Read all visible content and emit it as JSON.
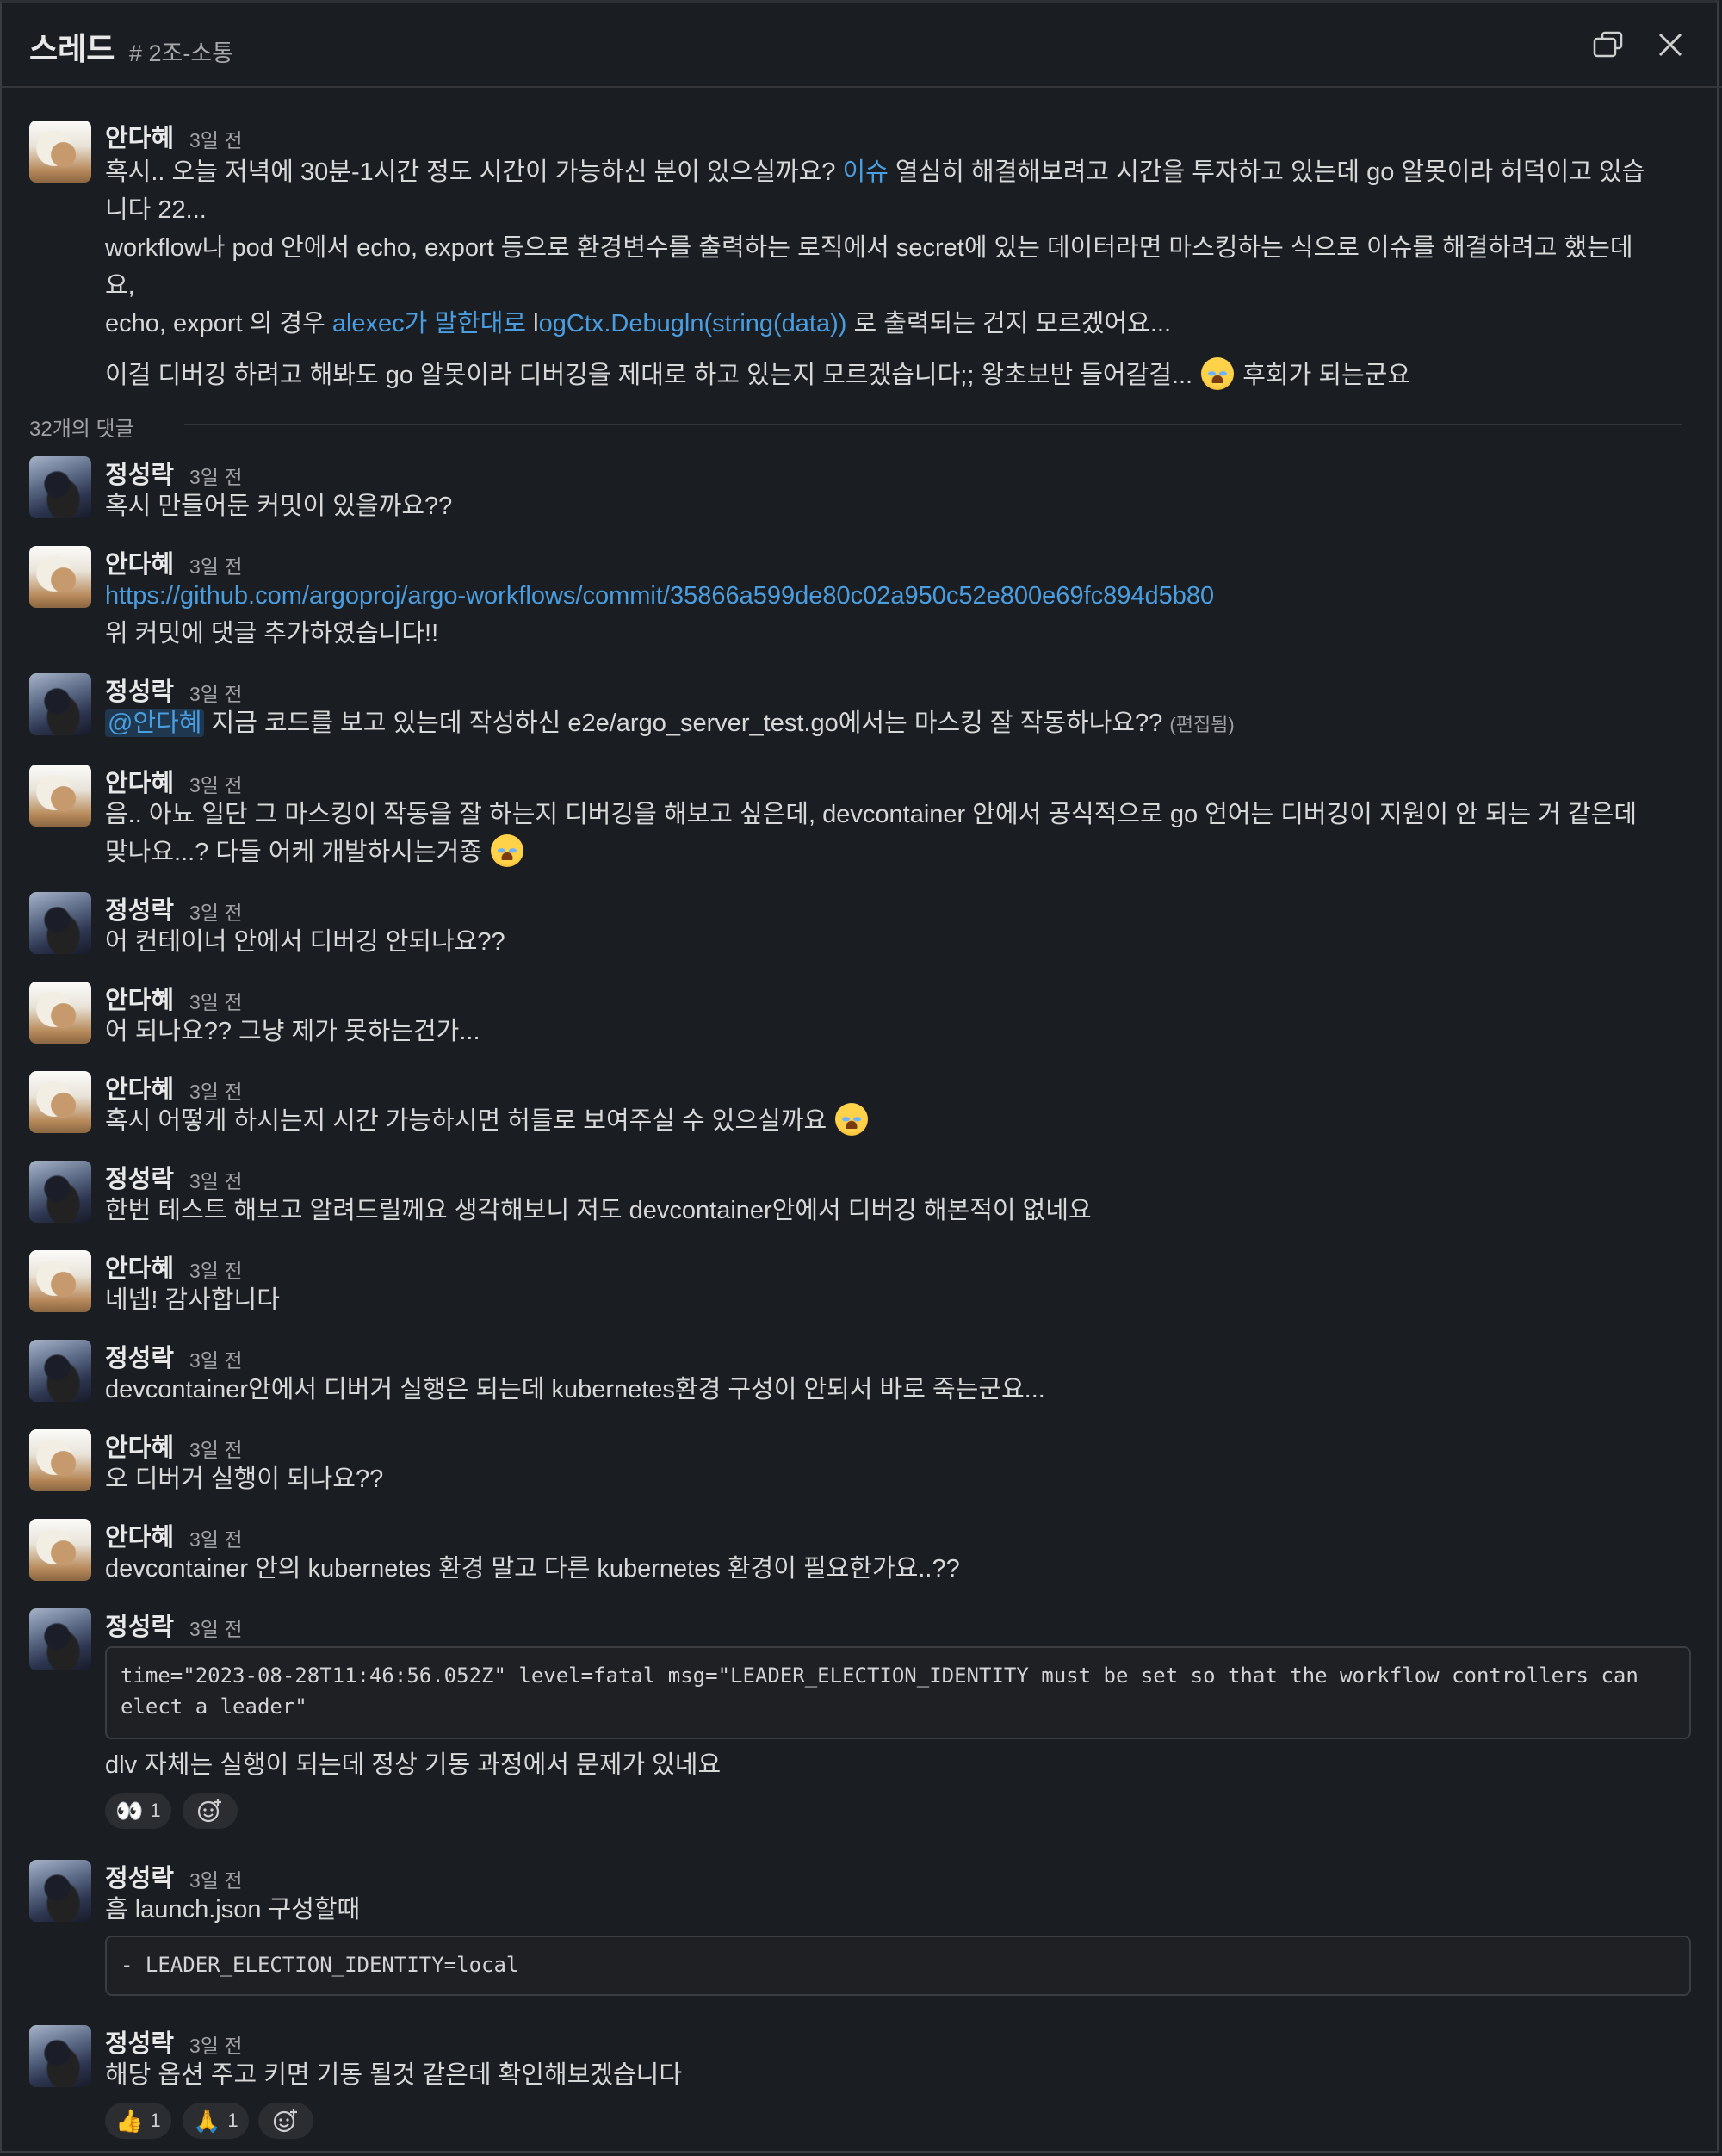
{
  "header": {
    "title": "스레드",
    "channel": "# 2조-소통"
  },
  "parent": {
    "author": "안다혜",
    "time": "3일 전",
    "lines": {
      "l1a": "혹시.. 오늘 저녁에 30분-1시간 정도 시간이 가능하신 분이 있으실까요? ",
      "l1link": "이슈",
      "l1b": " 열심히 해결해보려고 시간을 투자하고 있는데 go 알못이라 허덕이고 있습",
      "l2": "니다 22...",
      "l3": "workflow나 pod 안에서 echo, export 등으로 환경변수를 출력하는 로직에서 secret에 있는 데이터라면 마스킹하는 식으로 이슈를 해결하려고 했는데",
      "l4": "요,",
      "l5a": "echo, export 의 경우 ",
      "l5link": "alexec가 말한대로",
      "l5b": " l",
      "l5link2": "ogCtx.Debugln(string(data))",
      "l5c": " 로 출력되는 건지 모르겠어요...",
      "l6a": "이걸 디버깅 하려고 해봐도 go 알못이라 디버깅을 제대로 하고 있는지 모르겠습니다;; 왕초보반 들어갈걸... ",
      "l6b": " 후회가 되는군요"
    }
  },
  "reply_count": "32개의 댓글",
  "replies": [
    {
      "author": "정성락",
      "time": "3일 전",
      "text": "혹시 만들어둔 커밋이 있을까요??"
    },
    {
      "author": "안다혜",
      "time": "3일 전",
      "link": "https://github.com/argoproj/argo-workflows/commit/35866a599de80c02a950c52e800e69fc894d5b80",
      "text": "위 커밋에 댓글 추가하였습니다!!"
    },
    {
      "author": "정성락",
      "time": "3일 전",
      "mention": "@안다혜",
      "text": " 지금 코드를 보고 있는데 작성하신 e2e/argo_server_test.go에서는 마스킹 잘 작동하나요?? ",
      "edited": "(편집됨)"
    },
    {
      "author": "안다혜",
      "time": "3일 전",
      "text": "음.. 아뇨 일단 그 마스킹이 작동을 잘 하는지 디버깅을 해보고 싶은데, devcontainer 안에서 공식적으로 go 언어는 디버깅이 지원이 안 되는 거 같은데",
      "text2": "맞나요...? 다들 어케 개발하시는거죵 "
    },
    {
      "author": "정성락",
      "time": "3일 전",
      "text": "어 컨테이너 안에서 디버깅 안되나요??"
    },
    {
      "author": "안다혜",
      "time": "3일 전",
      "text": "어 되나요?? 그냥 제가 못하는건가..."
    },
    {
      "author": "안다혜",
      "time": "3일 전",
      "text": "혹시 어떻게 하시는지 시간 가능하시면 허들로 보여주실 수 있으실까요 "
    },
    {
      "author": "정성락",
      "time": "3일 전",
      "text": "한번 테스트 해보고 알려드릴께요 생각해보니 저도 devcontainer안에서 디버깅 해본적이 없네요"
    },
    {
      "author": "안다혜",
      "time": "3일 전",
      "text": "네넵! 감사합니다"
    },
    {
      "author": "정성락",
      "time": "3일 전",
      "text": "devcontainer안에서 디버거 실행은 되는데 kubernetes환경 구성이 안되서 바로 죽는군요..."
    },
    {
      "author": "안다혜",
      "time": "3일 전",
      "text": "오 디버거 실행이 되나요??"
    },
    {
      "author": "안다혜",
      "time": "3일 전",
      "text": "devcontainer 안의 kubernetes 환경 말고 다른 kubernetes 환경이 필요한가요..??"
    },
    {
      "author": "정성락",
      "time": "3일 전",
      "code": "time=\"2023-08-28T11:46:56.052Z\" level=fatal msg=\"LEADER_ELECTION_IDENTITY must be set so that the workflow controllers can\nelect a leader\"",
      "text": "dlv 자체는 실행이 되는데 정상 기동 과정에서 문제가 있네요",
      "reaction_count": "1"
    },
    {
      "author": "정성락",
      "time": "3일 전",
      "text": "흠 launch.json 구성할때",
      "code": "- LEADER_ELECTION_IDENTITY=local"
    },
    {
      "author": "정성락",
      "time": "3일 전",
      "text": "해당 옵션 주고 키면 기동 될것 같은데 확인해보겠습니다",
      "reaction1_count": "1",
      "reaction2_count": "1"
    }
  ],
  "icons": {
    "popout": "popout-icon",
    "close": "close-icon",
    "add_reaction": "add-reaction-icon",
    "eyes": "eyes-emoji",
    "thumbs": "thumbs-up-emoji",
    "pray": "pray-emoji",
    "crying": "crying-emoji"
  },
  "colors": {
    "background": "#1a1d21",
    "link": "#4a9ee0",
    "text": "#d8d8d8"
  }
}
